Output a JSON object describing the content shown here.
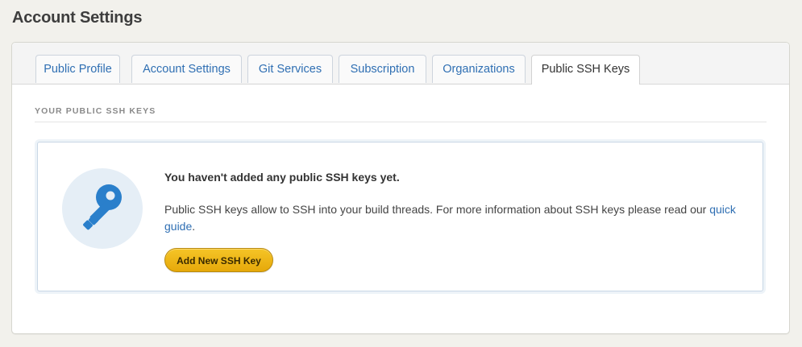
{
  "page": {
    "title": "Account Settings"
  },
  "tabs": [
    {
      "label": "Public Profile",
      "active": false
    },
    {
      "label": "Account Settings",
      "active": false
    },
    {
      "label": "Git Services",
      "active": false
    },
    {
      "label": "Subscription",
      "active": false
    },
    {
      "label": "Organizations",
      "active": false
    },
    {
      "label": "Public SSH Keys",
      "active": true
    }
  ],
  "section": {
    "heading": "YOUR PUBLIC SSH KEYS"
  },
  "empty_state": {
    "icon": "key-icon",
    "title": "You haven't added any public SSH keys yet.",
    "description_prefix": "Public SSH keys allow to SSH into your build threads. For more information about SSH keys please read our ",
    "link_text": "quick guide",
    "description_suffix": ".",
    "button_label": "Add New SSH Key"
  },
  "colors": {
    "background": "#f2f1ec",
    "link": "#2f6fb3",
    "key_icon": "#2a7fcb",
    "icon_circle": "#e5eef6",
    "button": "#f0b81a"
  }
}
